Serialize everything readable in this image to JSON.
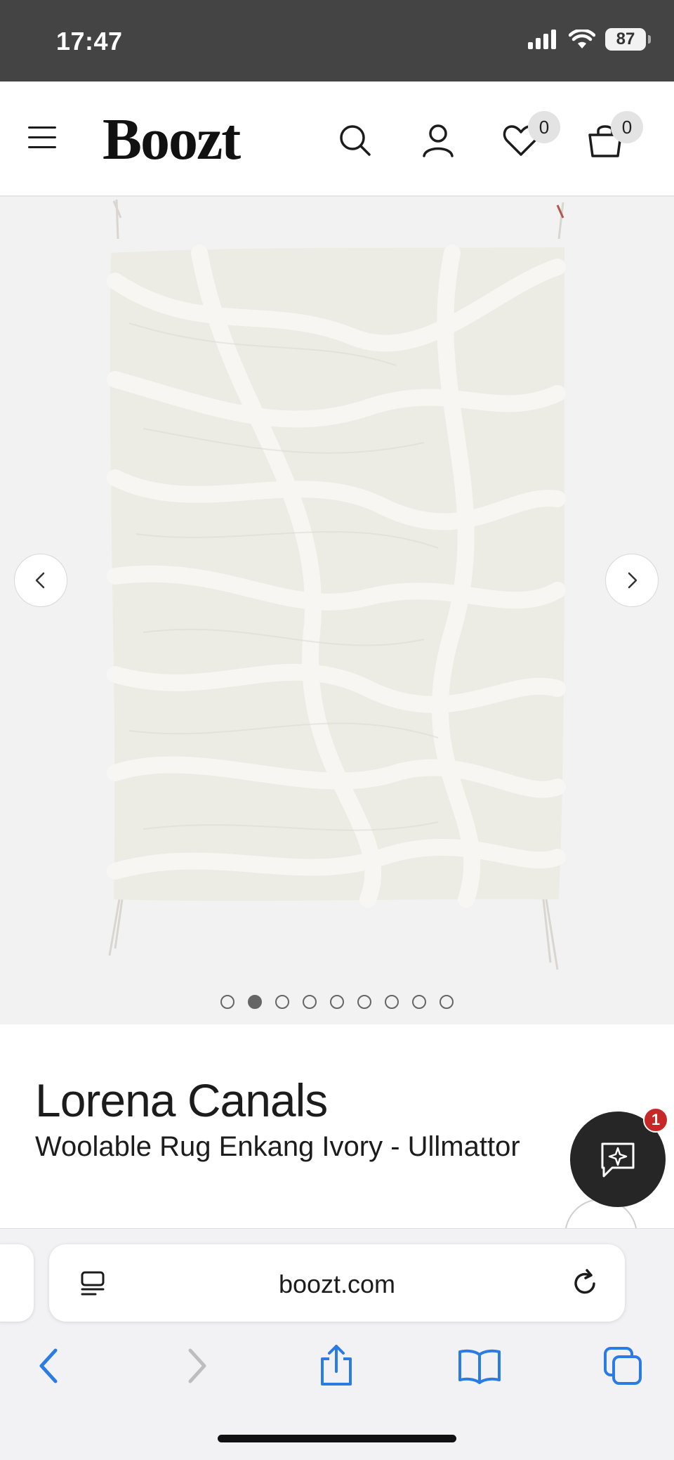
{
  "status_bar": {
    "time": "17:47",
    "battery": "87",
    "icons": [
      "signal-icon",
      "wifi-icon",
      "battery-icon"
    ]
  },
  "header": {
    "logo": "Boozt",
    "icons": [
      "menu-icon",
      "search-icon",
      "account-icon",
      "wishlist-icon",
      "cart-icon"
    ],
    "wishlist_count": "0",
    "cart_count": "0"
  },
  "gallery": {
    "image_alt_icon": "rug-image",
    "slide_count": 9,
    "active_slide_index": 1,
    "prev_icon": "chevron-left-icon",
    "next_icon": "chevron-right-icon"
  },
  "product": {
    "brand": "Lorena Canals",
    "name": "Woolable Rug Enkang Ivory - Ullmattor"
  },
  "chat": {
    "icon": "chat-sparkle-icon",
    "badge": "1"
  },
  "browser": {
    "url": "boozt.com",
    "toolbar_icons": [
      "back-icon",
      "forward-icon",
      "share-icon",
      "bookmarks-icon",
      "tabs-icon"
    ],
    "accent_color": "#2a7be4"
  },
  "colors": {
    "status_bar_bg": "#444444",
    "gallery_bg": "#f2f2f2",
    "chat_bg": "#262626",
    "chat_badge": "#c62828"
  }
}
